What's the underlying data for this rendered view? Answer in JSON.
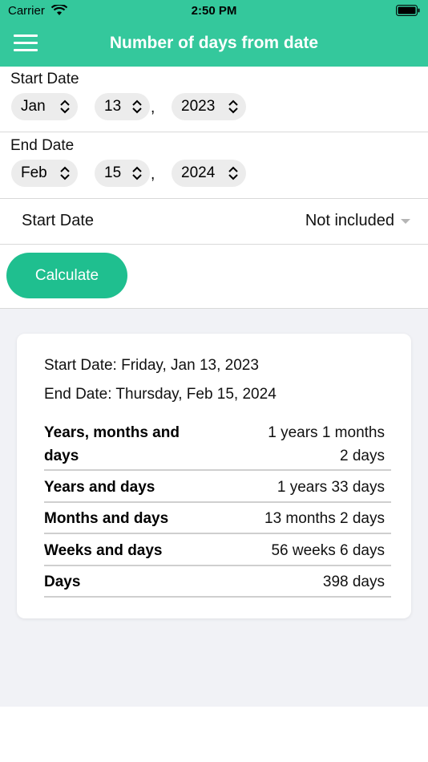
{
  "status_bar": {
    "carrier": "Carrier",
    "time": "2:50 PM"
  },
  "nav": {
    "title": "Number of days from date",
    "menu_icon": "hamburger-menu-icon"
  },
  "start": {
    "label": "Start Date",
    "month": "Jan",
    "day": "13",
    "year": "2023"
  },
  "end": {
    "label": "End Date",
    "month": "Feb",
    "day": "15",
    "year": "2024"
  },
  "comma": ",",
  "option": {
    "label": "Start Date",
    "value": "Not included"
  },
  "calculate_label": "Calculate",
  "result": {
    "start_line": "Start Date: Friday, Jan 13, 2023",
    "end_line": "End Date: Thursday, Feb 15, 2024",
    "rows": [
      {
        "label_line1": "Years, months and",
        "label_line2": "days",
        "value_line1": "1 years 1 months",
        "value_line2": "2 days"
      },
      {
        "label": "Years and days",
        "value": "1 years 33 days"
      },
      {
        "label": "Months and days",
        "value": "13 months 2 days"
      },
      {
        "label": "Weeks and days",
        "value": "56 weeks 6 days"
      },
      {
        "label": "Days",
        "value": "398 days"
      }
    ]
  },
  "colors": {
    "header": "#34c89c",
    "button": "#1fbf8f",
    "background": "#f1f2f6"
  }
}
